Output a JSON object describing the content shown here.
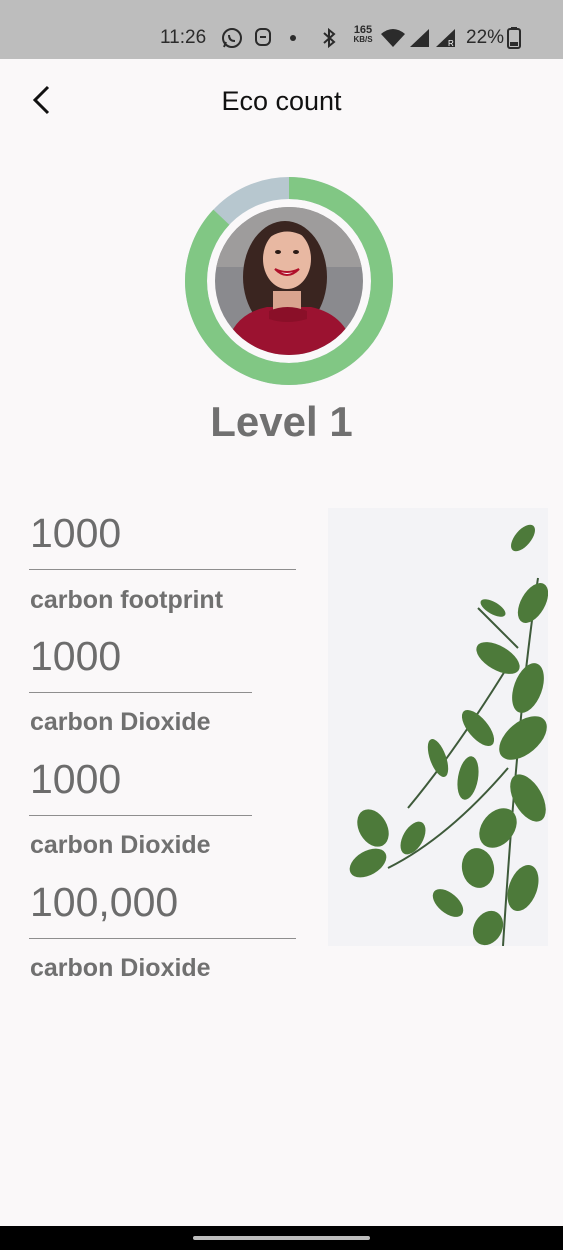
{
  "status_bar": {
    "time": "11:26",
    "net_speed_top": "165",
    "net_speed_bottom": "KB/S",
    "battery": "22%"
  },
  "app_bar": {
    "title": "Eco count"
  },
  "profile": {
    "level": "Level 1",
    "progress_fraction": 0.87,
    "progress_color": "#81c784",
    "track_color": "#b7c7cf"
  },
  "stats": [
    {
      "value": "1000",
      "label": "carbon footprint"
    },
    {
      "value": "1000",
      "label": "carbon Dioxide"
    },
    {
      "value": "1000",
      "label": "carbon Dioxide"
    },
    {
      "value": "100,000",
      "label": "carbon Dioxide"
    }
  ]
}
